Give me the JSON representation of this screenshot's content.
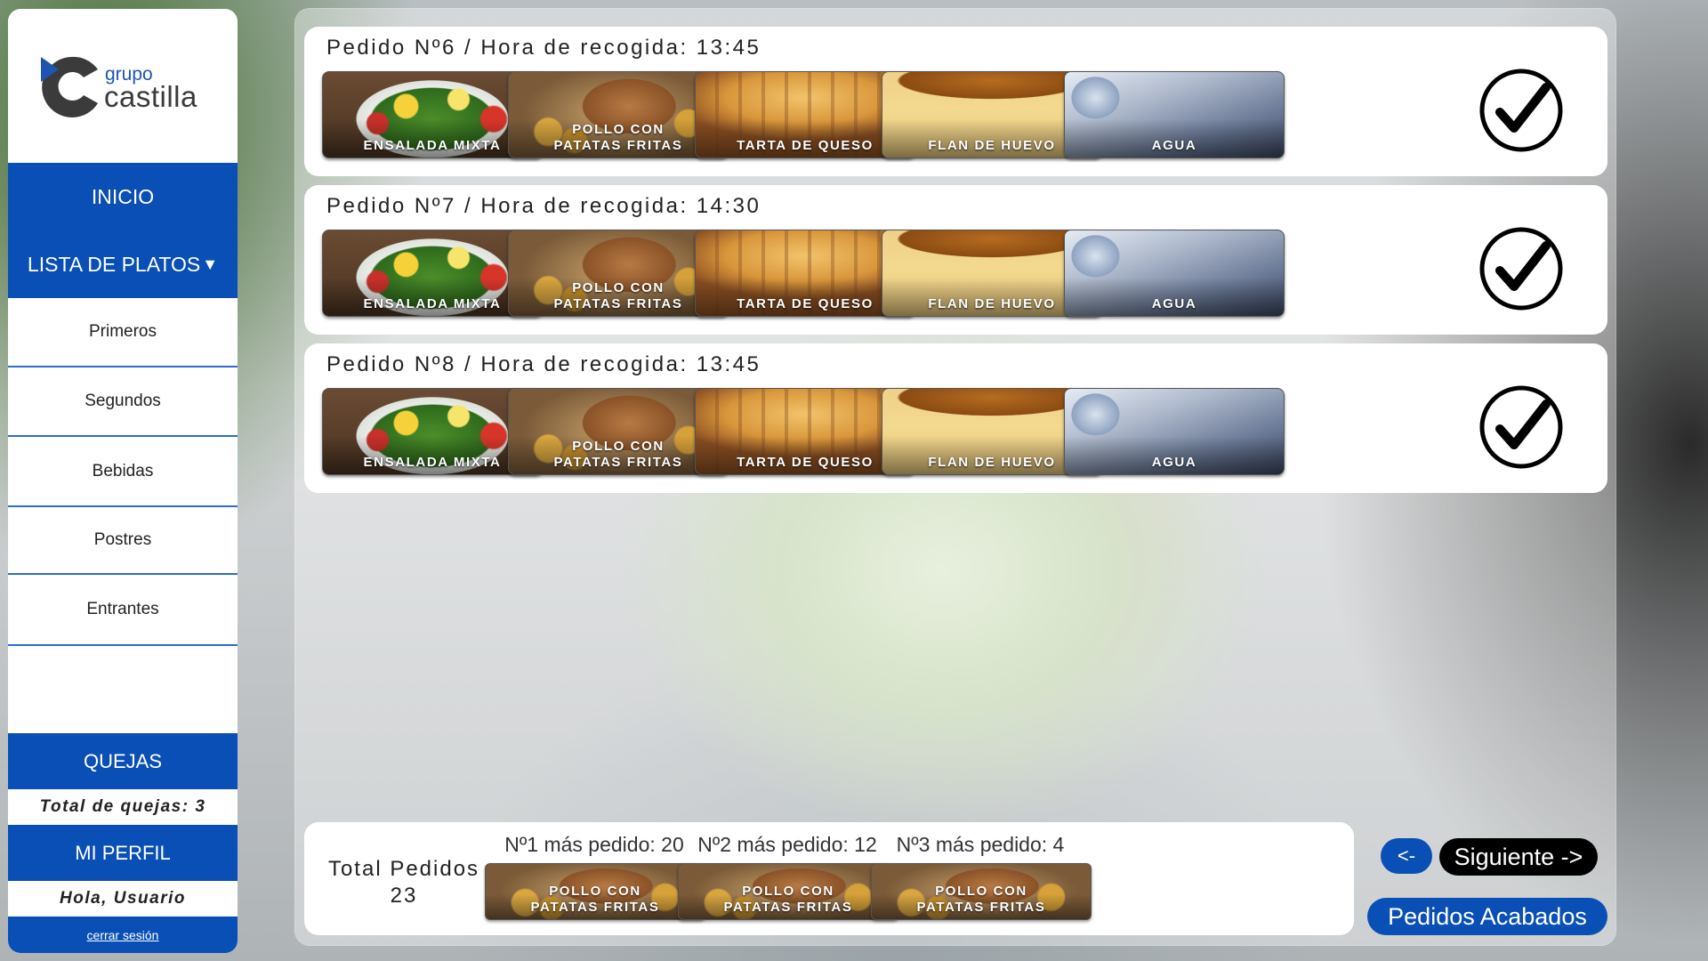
{
  "sidebar": {
    "logo": {
      "line1": "grupo",
      "line2": "castilla"
    },
    "nav": {
      "inicio": "INICIO",
      "lista": "LISTA DE PLATOS",
      "lista_arrow": "▼"
    },
    "categories": [
      "Primeros",
      "Segundos",
      "Bebidas",
      "Postres",
      "Entrantes"
    ],
    "quejas": "QUEJAS",
    "quejas_total": "Total de quejas: 3",
    "perfil": "MI PERFIL",
    "greeting": "Hola, Usuario",
    "logout": "cerrar sesión"
  },
  "orders": [
    {
      "title": "Pedido Nº6 / Hora de recogida: 13:45",
      "dishes": [
        {
          "label": "ENSALADA MIXTA",
          "image": "ensalada"
        },
        {
          "label1": "POLLO CON",
          "label2": "PATATAS FRITAS",
          "image": "pollo"
        },
        {
          "label": "TARTA DE QUESO",
          "image": "tarta"
        },
        {
          "label": "FLAN DE HUEVO",
          "image": "flan"
        },
        {
          "label": "AGUA",
          "image": "agua"
        }
      ]
    },
    {
      "title": "Pedido Nº7 / Hora de recogida: 14:30",
      "dishes": [
        {
          "label": "ENSALADA MIXTA",
          "image": "ensalada"
        },
        {
          "label1": "POLLO CON",
          "label2": "PATATAS FRITAS",
          "image": "pollo"
        },
        {
          "label": "TARTA DE QUESO",
          "image": "tarta"
        },
        {
          "label": "FLAN DE HUEVO",
          "image": "flan"
        },
        {
          "label": "AGUA",
          "image": "agua"
        }
      ]
    },
    {
      "title": "Pedido Nº8 / Hora de recogida: 13:45",
      "dishes": [
        {
          "label": "ENSALADA MIXTA",
          "image": "ensalada"
        },
        {
          "label1": "POLLO CON",
          "label2": "PATATAS FRITAS",
          "image": "pollo"
        },
        {
          "label": "TARTA DE QUESO",
          "image": "tarta"
        },
        {
          "label": "FLAN DE HUEVO",
          "image": "flan"
        },
        {
          "label": "AGUA",
          "image": "agua"
        }
      ]
    }
  ],
  "check_icon": "checkmark-circle-icon",
  "stats": {
    "total_label": "Total Pedidos",
    "total_value": "23",
    "top": [
      {
        "title": "Nº1 más pedido: 20",
        "label1": "POLLO CON",
        "label2": "PATATAS FRITAS"
      },
      {
        "title": "Nº2 más pedido: 12",
        "label1": "POLLO CON",
        "label2": "PATATAS FRITAS"
      },
      {
        "title": "Nº3 más pedido: 4",
        "label1": "POLLO CON",
        "label2": "PATATAS FRITAS"
      }
    ]
  },
  "buttons": {
    "prev": "<-",
    "next": "Siguiente ->",
    "done": "Pedidos Acabados"
  },
  "colors": {
    "brand_blue": "#0a4fb5",
    "black": "#000000"
  }
}
